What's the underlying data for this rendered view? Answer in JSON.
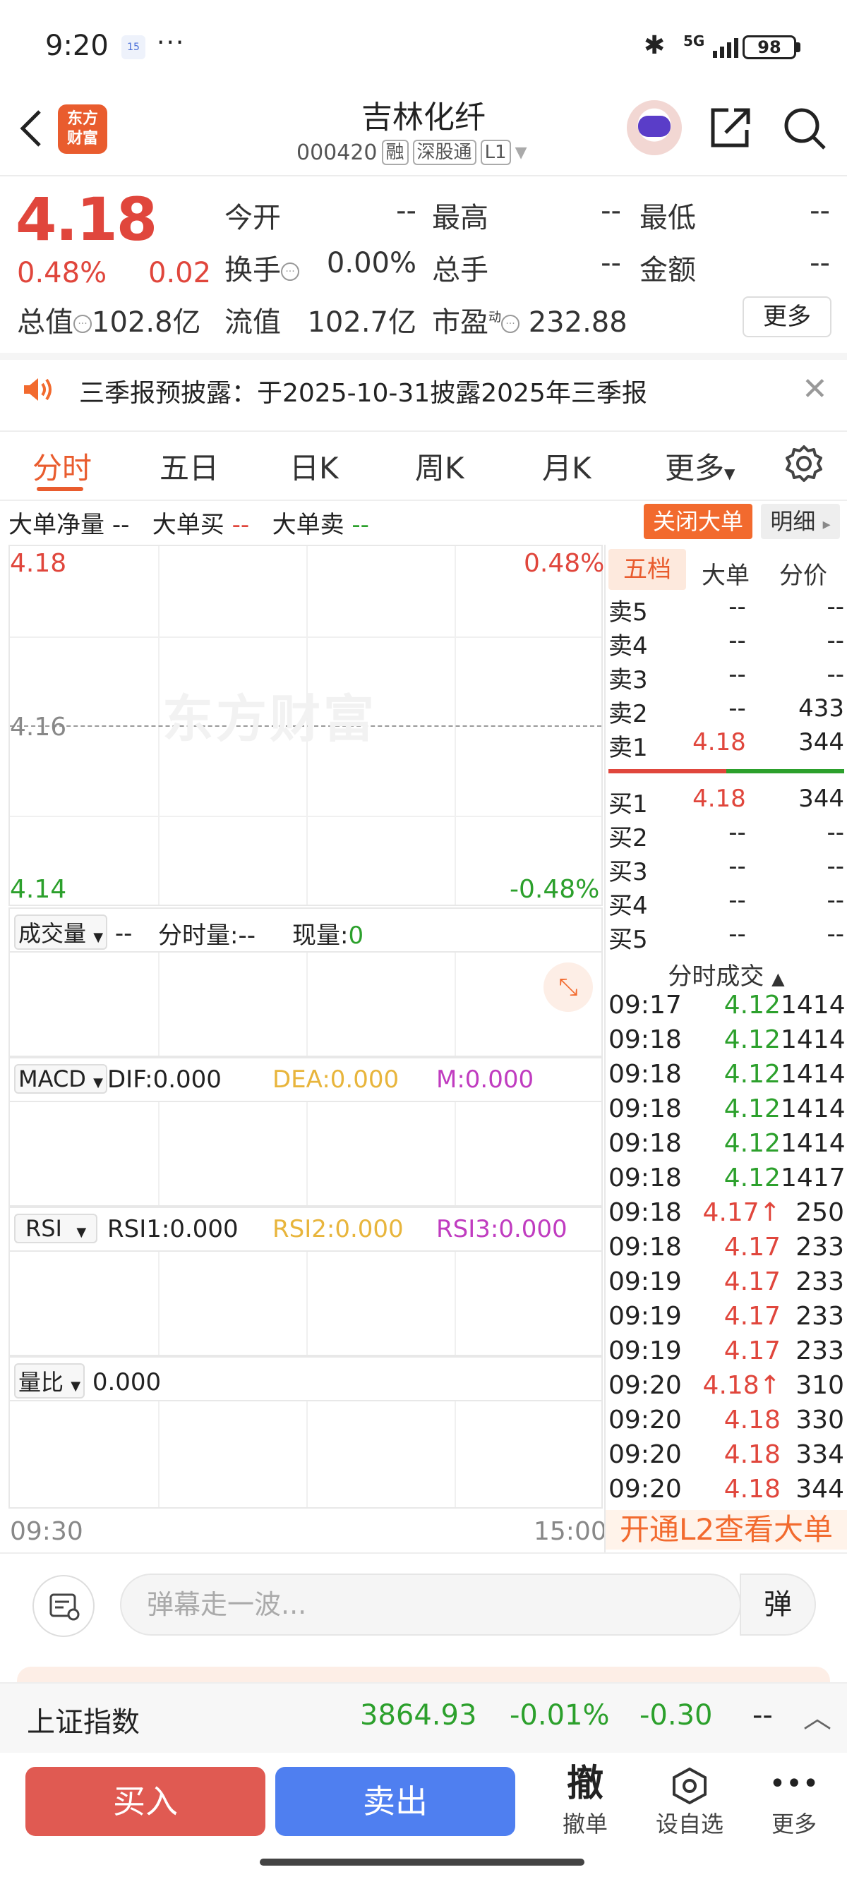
{
  "status": {
    "time": "9:20",
    "calendar": "15",
    "network": "5G",
    "battery": "98"
  },
  "header": {
    "title": "吉林化纤",
    "code": "000420",
    "tags": [
      "融",
      "深股通",
      "L1"
    ],
    "logo": "东方\n财富"
  },
  "quote": {
    "price": "4.18",
    "pct": "0.48%",
    "change": "0.02",
    "rows": [
      [
        [
          "今开",
          "--"
        ],
        [
          "最高",
          "--"
        ],
        [
          "最低",
          "--"
        ]
      ],
      [
        [
          "换手",
          "0.00%"
        ],
        [
          "总手",
          "--"
        ],
        [
          "金额",
          "--"
        ]
      ]
    ],
    "cap_label": "总值",
    "cap_value": "102.8亿",
    "float_label": "流值",
    "float_value": "102.7亿",
    "pe_label": "市盈",
    "pe_sup": "动",
    "pe_value": "232.88",
    "more": "更多"
  },
  "notice": {
    "text": "三季报预披露：于2025-10-31披露2025年三季报"
  },
  "tabs": [
    "分时",
    "五日",
    "日K",
    "周K",
    "月K",
    "更多"
  ],
  "bigorder": {
    "net_label": "大单净量",
    "net": "--",
    "buy_label": "大单买",
    "buy": "--",
    "sell_label": "大单卖",
    "sell": "--",
    "close": "关闭大单",
    "detail": "明细"
  },
  "chart": {
    "y_high": "4.18",
    "y_mid": "4.16",
    "y_low": "4.14",
    "pct_high": "0.48%",
    "pct_low": "-0.48%",
    "watermark": "东方财富",
    "time_start": "09:30",
    "time_end": "15:00"
  },
  "volume": {
    "select": "成交量",
    "value": "--",
    "min_label": "分时量:",
    "min_value": "--",
    "cur_label": "现量:",
    "cur_value": "0"
  },
  "macd": {
    "select": "MACD",
    "dif": "DIF:0.000",
    "dea": "DEA:0.000",
    "m": "M:0.000"
  },
  "rsi": {
    "select": "RSI",
    "rsi1": "RSI1:0.000",
    "rsi2": "RSI2:0.000",
    "rsi3": "RSI3:0.000"
  },
  "ratio": {
    "select": "量比",
    "value": "0.000"
  },
  "orderbook": {
    "tabs": [
      "五档",
      "大单",
      "分价"
    ],
    "sells": [
      {
        "label": "卖5",
        "price": "--",
        "vol": "--"
      },
      {
        "label": "卖4",
        "price": "--",
        "vol": "--"
      },
      {
        "label": "卖3",
        "price": "--",
        "vol": "--"
      },
      {
        "label": "卖2",
        "price": "--",
        "vol": "433"
      },
      {
        "label": "卖1",
        "price": "4.18",
        "vol": "344"
      }
    ],
    "buys": [
      {
        "label": "买1",
        "price": "4.18",
        "vol": "344"
      },
      {
        "label": "买2",
        "price": "--",
        "vol": "--"
      },
      {
        "label": "买3",
        "price": "--",
        "vol": "--"
      },
      {
        "label": "买4",
        "price": "--",
        "vol": "--"
      },
      {
        "label": "买5",
        "price": "--",
        "vol": "--"
      }
    ],
    "ticks_header": "分时成交",
    "ticks": [
      {
        "t": "09:17",
        "p": "4.12",
        "v": "1414",
        "c": "green"
      },
      {
        "t": "09:18",
        "p": "4.12",
        "v": "1414",
        "c": "green"
      },
      {
        "t": "09:18",
        "p": "4.12",
        "v": "1414",
        "c": "green"
      },
      {
        "t": "09:18",
        "p": "4.12",
        "v": "1414",
        "c": "green"
      },
      {
        "t": "09:18",
        "p": "4.12",
        "v": "1414",
        "c": "green"
      },
      {
        "t": "09:18",
        "p": "4.12",
        "v": "1417",
        "c": "green"
      },
      {
        "t": "09:18",
        "p": "4.17↑",
        "v": "250",
        "c": "red"
      },
      {
        "t": "09:18",
        "p": "4.17",
        "v": "233",
        "c": "red"
      },
      {
        "t": "09:19",
        "p": "4.17",
        "v": "233",
        "c": "red"
      },
      {
        "t": "09:19",
        "p": "4.17",
        "v": "233",
        "c": "red"
      },
      {
        "t": "09:19",
        "p": "4.17",
        "v": "233",
        "c": "red"
      },
      {
        "t": "09:20",
        "p": "4.18↑",
        "v": "310",
        "c": "red"
      },
      {
        "t": "09:20",
        "p": "4.18",
        "v": "330",
        "c": "red"
      },
      {
        "t": "09:20",
        "p": "4.18",
        "v": "334",
        "c": "red"
      },
      {
        "t": "09:20",
        "p": "4.18",
        "v": "344",
        "c": "red"
      }
    ],
    "l2": "开通L2查看大单"
  },
  "danmaku": {
    "placeholder": "弹幕走一波...",
    "button": "弹"
  },
  "index": {
    "name": "上证指数",
    "value": "3864.93",
    "pct": "-0.01%",
    "chg": "-0.30",
    "extra": "--"
  },
  "actions": {
    "buy": "买入",
    "sell": "卖出",
    "cancel": "撤单",
    "cancel_icon": "撤",
    "watch": "设自选",
    "more": "更多"
  },
  "colors": {
    "up": "#e0463c",
    "down": "#2ca02c",
    "accent": "#e95c2e",
    "buy": "#e05a52",
    "sell": "#4f7ff0"
  }
}
